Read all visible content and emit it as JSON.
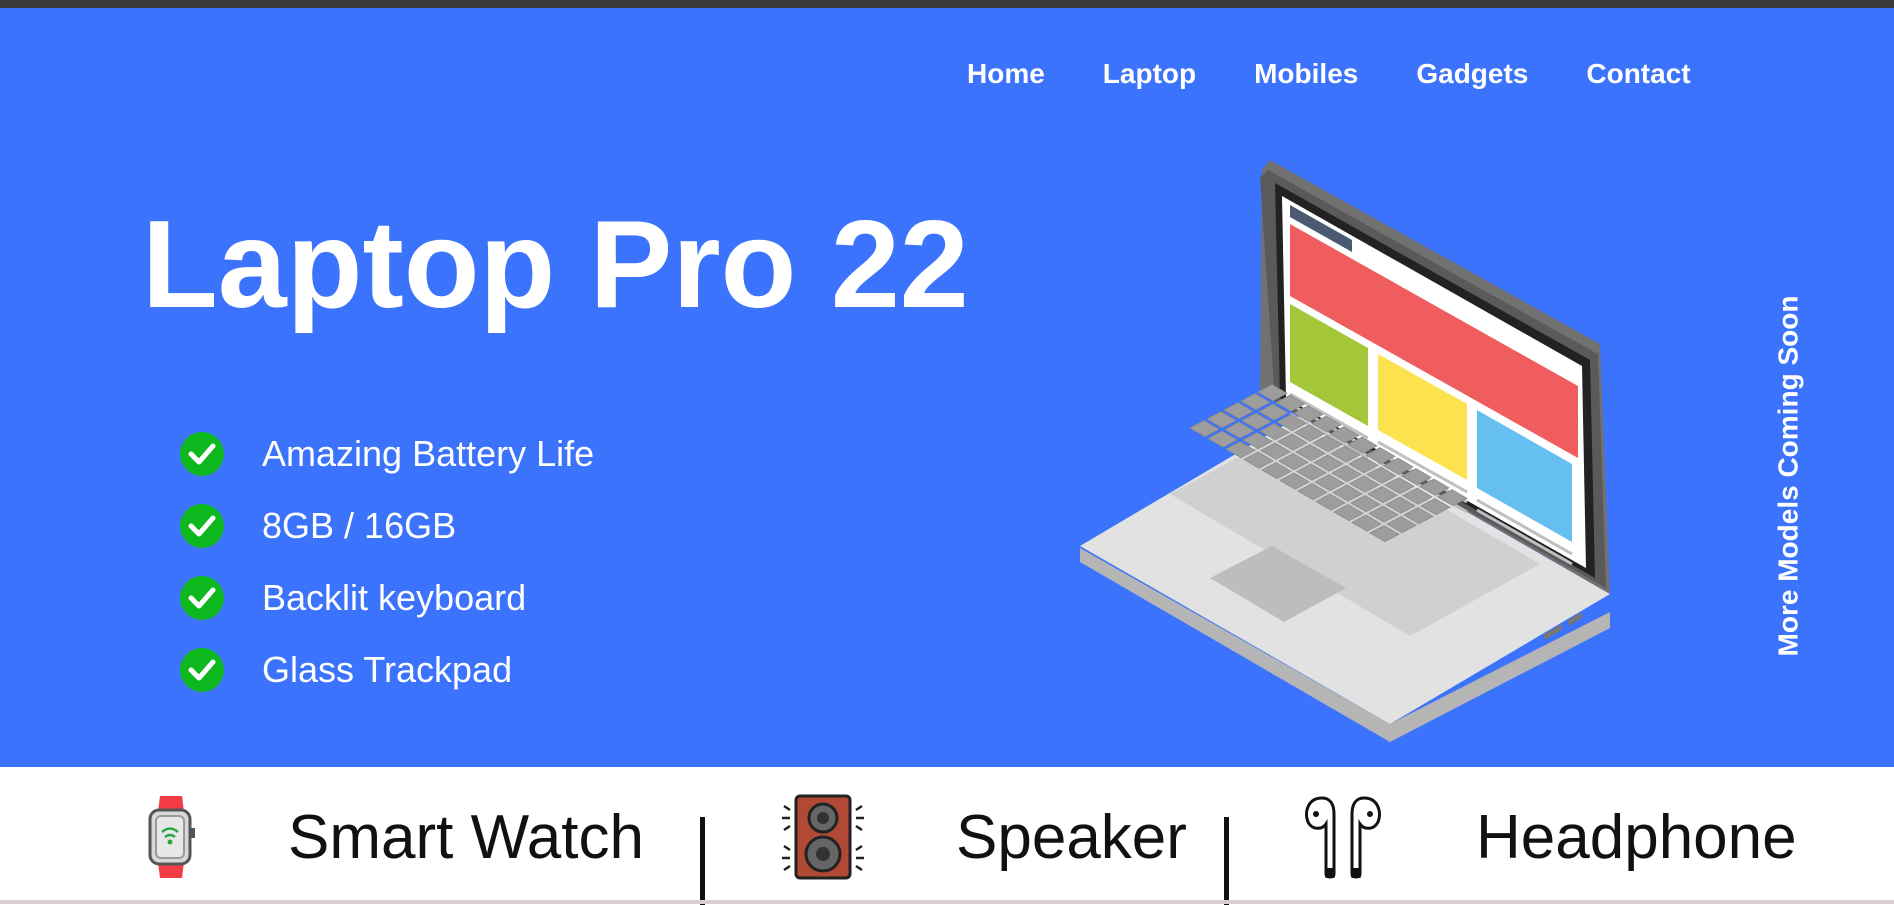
{
  "nav": {
    "items": [
      {
        "label": "Home"
      },
      {
        "label": "Laptop"
      },
      {
        "label": "Mobiles"
      },
      {
        "label": "Gadgets"
      },
      {
        "label": "Contact"
      }
    ]
  },
  "hero": {
    "title": "Laptop Pro 22",
    "features": [
      {
        "label": "Amazing Battery Life",
        "icon": "check-icon"
      },
      {
        "label": "8GB / 16GB",
        "icon": "check-icon"
      },
      {
        "label": "Backlit keyboard",
        "icon": "check-icon"
      },
      {
        "label": "Glass Trackpad",
        "icon": "check-icon"
      }
    ],
    "image": "laptop-illustration",
    "side_text": "More Models Coming Soon"
  },
  "categories": [
    {
      "label": "Smart Watch",
      "icon": "smartwatch-icon"
    },
    {
      "label": "Speaker",
      "icon": "speaker-icon"
    },
    {
      "label": "Headphone",
      "icon": "headphone-icon"
    }
  ],
  "colors": {
    "hero_background": "#3b73fd",
    "check": "#0db81f",
    "text_light": "#ffffff",
    "text_dark": "#111111"
  }
}
